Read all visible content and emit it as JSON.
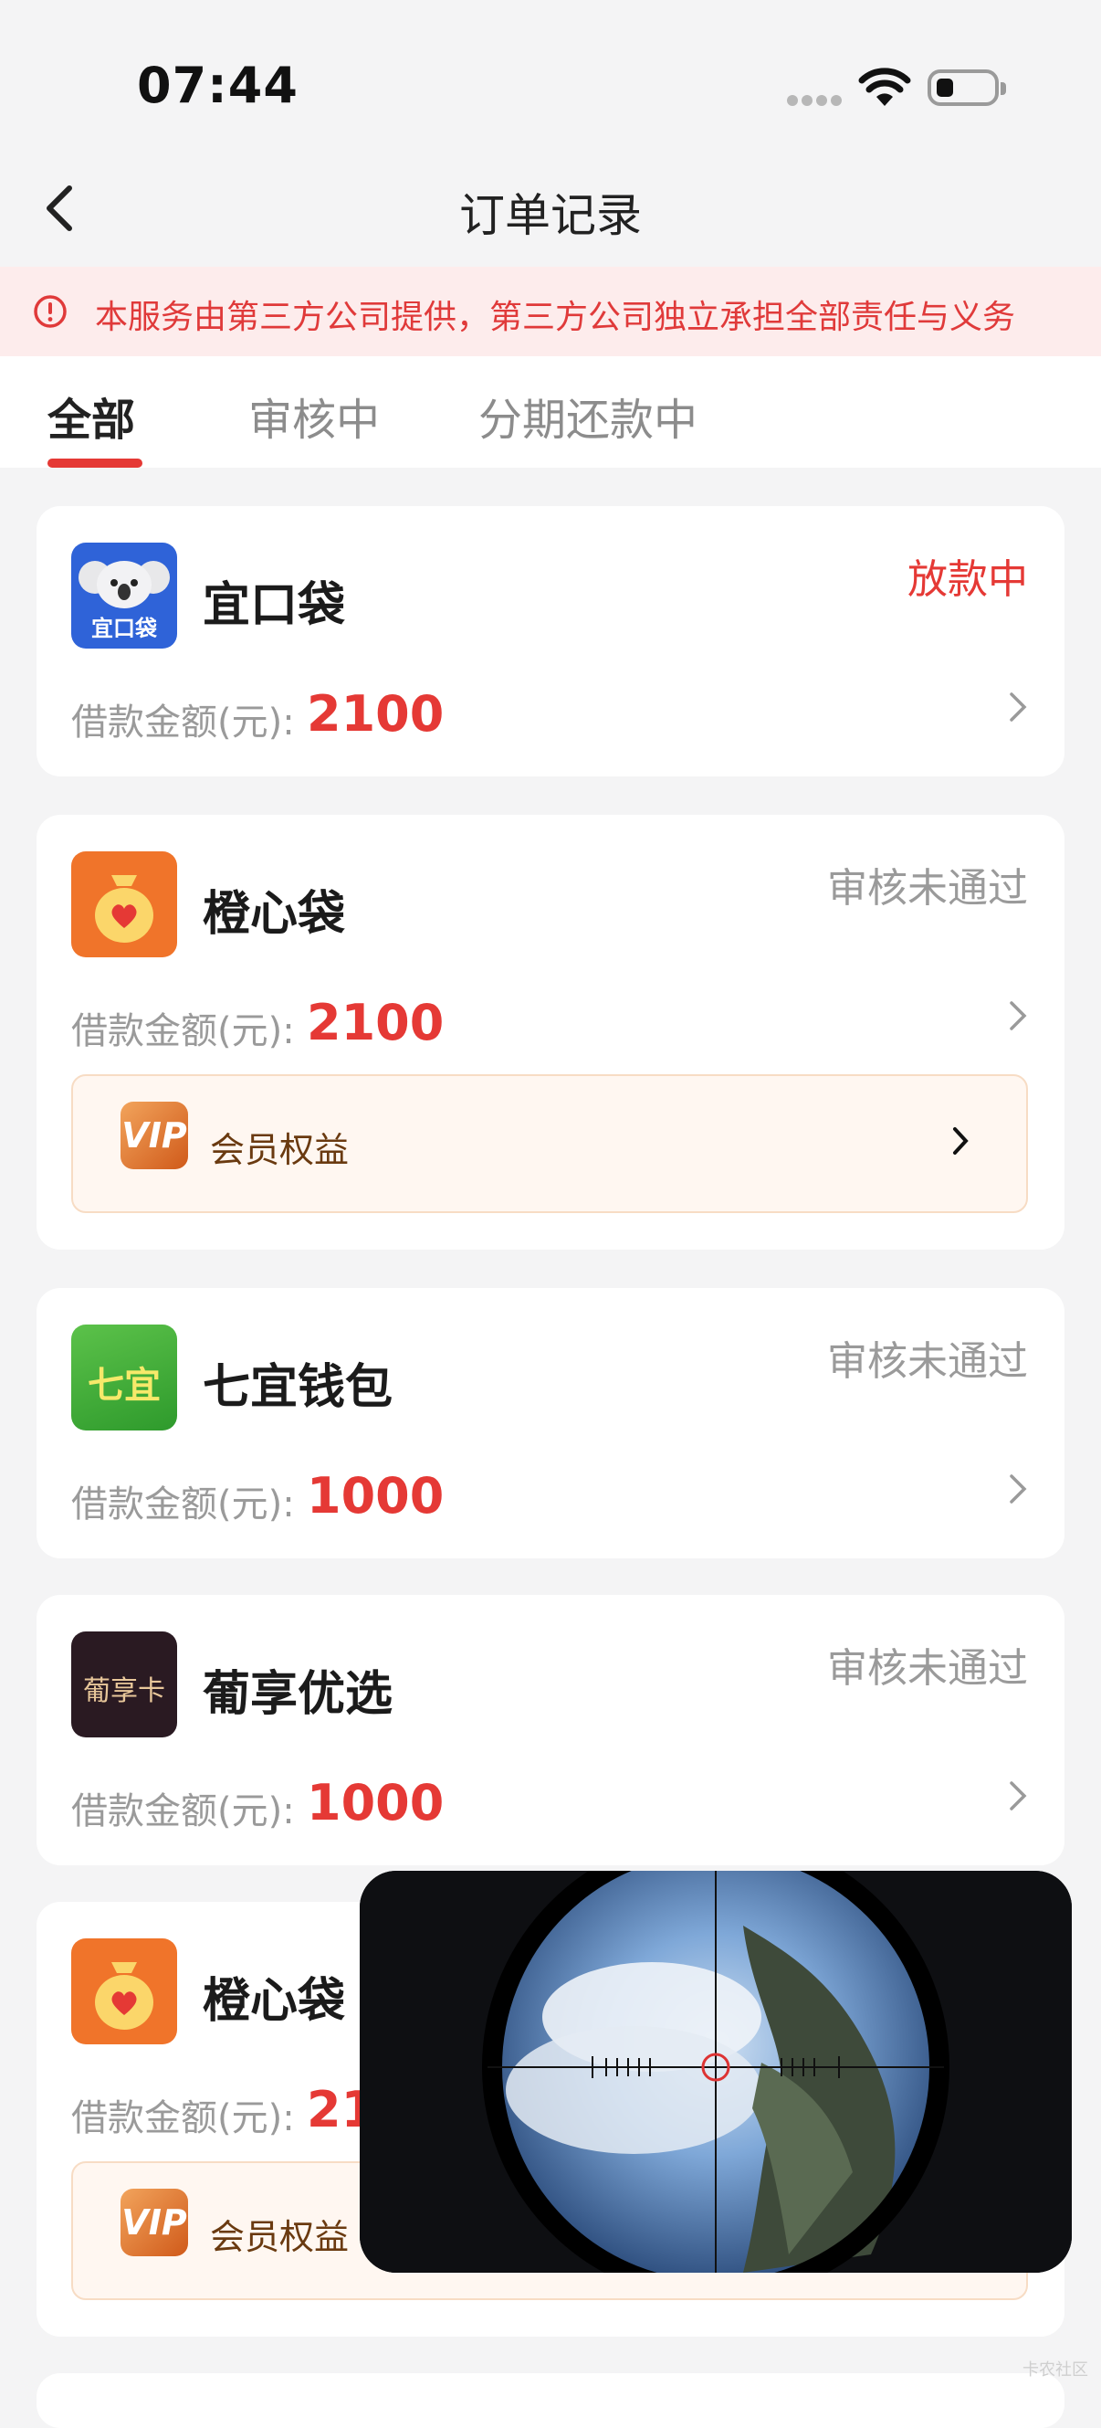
{
  "status_bar": {
    "time": "07:44"
  },
  "header": {
    "title": "订单记录"
  },
  "notice": {
    "text": "本服务由第三方公司提供，第三方公司独立承担全部责任与义务"
  },
  "tabs": [
    {
      "label": "全部",
      "active": true
    },
    {
      "label": "审核中",
      "active": false
    },
    {
      "label": "分期还款中",
      "active": false
    }
  ],
  "amount_label": "借款金额(元):",
  "orders": [
    {
      "name": "宜口袋",
      "status": "放款中",
      "amount": "2100",
      "logo_text": "宜口袋",
      "logo_icon": "koala-icon",
      "vip": false
    },
    {
      "name": "橙心袋",
      "status": "审核未通过",
      "amount": "2100",
      "logo_icon": "money-bag-heart-icon",
      "vip": true,
      "vip_label": "会员权益"
    },
    {
      "name": "七宜钱包",
      "status": "审核未通过",
      "amount": "1000",
      "logo_text": "七宜",
      "logo_icon": "qiyi-logo",
      "vip": false
    },
    {
      "name": "葡享优选",
      "status": "审核未通过",
      "amount": "1000",
      "logo_text": "葡享卡",
      "logo_icon": "puxiang-logo",
      "vip": false
    },
    {
      "name": "橙心袋",
      "status": "",
      "amount": "21",
      "logo_icon": "money-bag-heart-icon",
      "vip": true,
      "vip_label": "会员权益"
    }
  ],
  "vip_badge_text": "VIP",
  "watermark": "卡农社区",
  "colors": {
    "accent_red": "#e53935",
    "notice_bg": "#fdecec",
    "vip_bg": "#fff7f1"
  }
}
